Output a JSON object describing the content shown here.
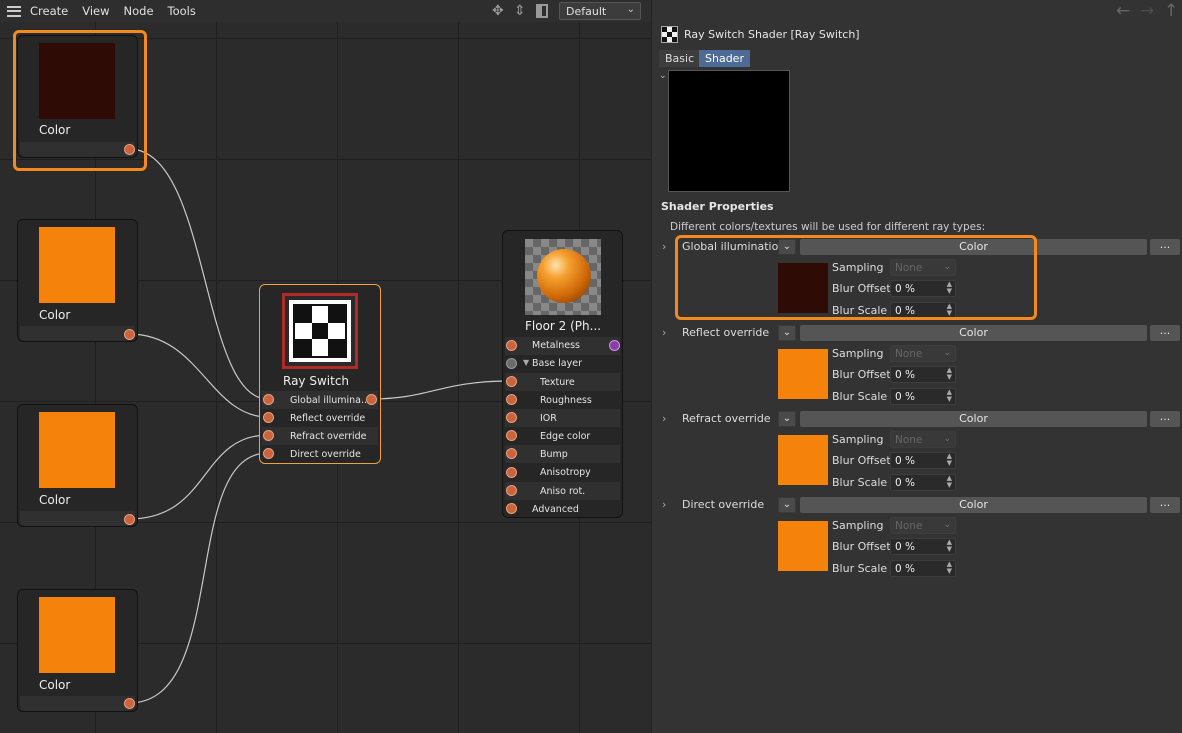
{
  "menu": {
    "items": [
      "Create",
      "View",
      "Node",
      "Tools"
    ]
  },
  "toolbar": {
    "layout_select": "Default"
  },
  "nodes": {
    "color_nodes": [
      {
        "title": "Color",
        "color": "#2e0b05"
      },
      {
        "title": "Color",
        "color": "#f5820a"
      },
      {
        "title": "Color",
        "color": "#f5820a"
      },
      {
        "title": "Color",
        "color": "#f5820a"
      }
    ],
    "ray_switch": {
      "title": "Ray Switch",
      "inputs": [
        "Global illumina...",
        "Reflect override",
        "Refract override",
        "Direct override"
      ]
    },
    "material": {
      "title": "Floor 2 (Ph...",
      "ports": [
        "Metalness",
        "Base layer",
        "Texture",
        "Roughness",
        "IOR",
        "Edge color",
        "Bump",
        "Anisotropy",
        "Aniso rot.",
        "Advanced"
      ]
    }
  },
  "panel": {
    "title": "Ray Switch Shader [Ray Switch]",
    "tabs": [
      "Basic",
      "Shader"
    ],
    "section_title": "Shader Properties",
    "description": "Different colors/textures will be used for different ray types:",
    "color_button": "Color",
    "dots_button": "...",
    "sampling_label": "Sampling",
    "sampling_value": "None",
    "blur_offset_label": "Blur Offset",
    "blur_scale_label": "Blur Scale",
    "groups": [
      {
        "label": "Global illumination",
        "swatch": "#2e0b05",
        "blur_offset": "0 %",
        "blur_scale": "0 %"
      },
      {
        "label": "Reflect override",
        "swatch": "#f5820a",
        "blur_offset": "0 %",
        "blur_scale": "0 %"
      },
      {
        "label": "Refract override",
        "swatch": "#f5820a",
        "blur_offset": "0 %",
        "blur_scale": "0 %"
      },
      {
        "label": "Direct override",
        "swatch": "#f5820a",
        "blur_offset": "0 %",
        "blur_scale": "0 %"
      }
    ]
  },
  "colors": {
    "highlight": "#f28a1f",
    "port": "#c9643f"
  },
  "icons": [
    "hamburger-icon",
    "move-icon",
    "arrow-up-down-icon",
    "panel-icon",
    "back-arrow-icon",
    "forward-arrow-icon",
    "up-arrow-icon",
    "checker-icon",
    "chevron-right-icon"
  ]
}
